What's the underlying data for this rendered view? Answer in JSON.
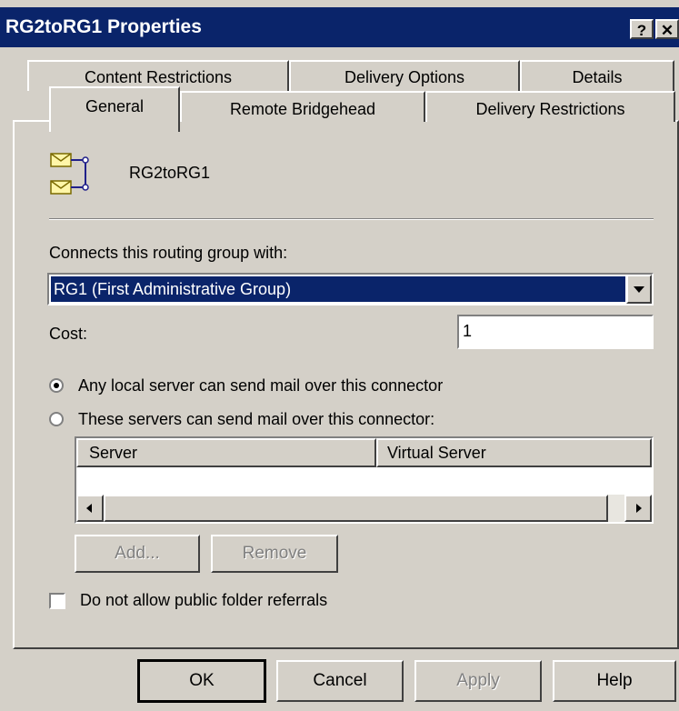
{
  "window": {
    "title": "RG2toRG1 Properties",
    "help_glyph": "?",
    "close_glyph": "✕"
  },
  "tabs": {
    "row1": [
      "Content Restrictions",
      "Delivery Options",
      "Details"
    ],
    "row2": [
      "General",
      "Remote Bridgehead",
      "Delivery Restrictions"
    ],
    "active": "General"
  },
  "general": {
    "connector_name": "RG2toRG1",
    "connects_label": "Connects this routing group with:",
    "routing_group_value": "RG1 (First Administrative Group)",
    "cost_label": "Cost:",
    "cost_value": "1",
    "radio_any_label": "Any local server can send mail over this connector",
    "radio_these_label": "These servers can send mail over this connector:",
    "radio_selected": "any",
    "server_list": {
      "columns": [
        "Server",
        "Virtual Server"
      ],
      "rows": []
    },
    "add_label": "Add...",
    "remove_label": "Remove",
    "public_folder_label": "Do not allow public folder referrals",
    "public_folder_checked": false
  },
  "footer": {
    "ok_label": "OK",
    "cancel_label": "Cancel",
    "apply_label": "Apply",
    "help_label": "Help"
  }
}
